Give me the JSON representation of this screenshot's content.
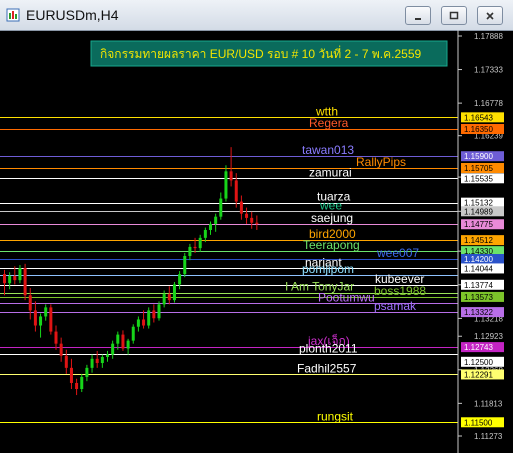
{
  "window": {
    "title": "EURUSDm,H4",
    "min_icon": "minimize-icon",
    "max_icon": "maximize-icon",
    "close_icon": "close-icon"
  },
  "header_text": "กิจกรรมทายผลราคา EUR/USD รอบ # 10 วันที่ 2 - 7 พ.ค.2559",
  "colors": {
    "background": "#000000",
    "bull": "#17d51a",
    "bear": "#e01414",
    "header_box": "#0a6b5c",
    "header_text": "#f2e600"
  },
  "axis_ticks": [
    "1.17888",
    "1.17333",
    "1.16778",
    "1.16239",
    "1.15555",
    "1.14989",
    "1.14330",
    "1.13774",
    "1.13218",
    "1.12923",
    "1.12368",
    "1.11813",
    "1.11273"
  ],
  "price_tags": [
    {
      "value": "1.16543",
      "bg": "#ffe100",
      "fg": "#000000"
    },
    {
      "value": "1.16350",
      "bg": "#ff6a00",
      "fg": "#000000"
    },
    {
      "value": "1.15900",
      "bg": "#6e5dd6",
      "fg": "#ffffff"
    },
    {
      "value": "1.15705",
      "bg": "#ff8a00",
      "fg": "#000000"
    },
    {
      "value": "1.15535",
      "bg": "#ffffff",
      "fg": "#000000"
    },
    {
      "value": "1.15132",
      "bg": "#ffffff",
      "fg": "#000000"
    },
    {
      "value": "1.14989",
      "bg": "#c8c8c8",
      "fg": "#000000"
    },
    {
      "value": "1.14775",
      "bg": "#e88ad8",
      "fg": "#000000"
    },
    {
      "value": "1.14512",
      "bg": "#ffa500",
      "fg": "#000000"
    },
    {
      "value": "1.14330",
      "bg": "#6be36b",
      "fg": "#000000"
    },
    {
      "value": "1.14200",
      "bg": "#2a52c9",
      "fg": "#ffffff"
    },
    {
      "value": "1.14044",
      "bg": "#ffffff",
      "fg": "#000000"
    },
    {
      "value": "1.13774",
      "bg": "#ffffff",
      "fg": "#000000"
    },
    {
      "value": "1.13573",
      "bg": "#7cc42a",
      "fg": "#000000"
    },
    {
      "value": "1.13322",
      "bg": "#b86ee8",
      "fg": "#000000"
    },
    {
      "value": "1.12743",
      "bg": "#c424c4",
      "fg": "#ffffff"
    },
    {
      "value": "1.12500",
      "bg": "#ffffff",
      "fg": "#000000"
    },
    {
      "value": "1.12291",
      "bg": "#ffff70",
      "fg": "#000000"
    },
    {
      "value": "1.11500",
      "bg": "#ffff00",
      "fg": "#000000"
    }
  ],
  "guesses": [
    {
      "name": "wtth",
      "value": 1.16543,
      "color": "#ffe100",
      "label_color": "#ffe100"
    },
    {
      "name": "Regera",
      "value": 1.1635,
      "color": "#ff6a00",
      "label_color": "#ff5a2a"
    },
    {
      "name": "tawan013",
      "value": 1.159,
      "color": "#6e5dd6",
      "label_color": "#8a7cff"
    },
    {
      "name": "RallyPips",
      "value": 1.15705,
      "color": "#ff8a00",
      "label_color": "#ff8a00"
    },
    {
      "name": "zamurai",
      "value": 1.15535,
      "color": "#ffffff",
      "label_color": "#ffffff"
    },
    {
      "name": "tuarza",
      "value": 1.15132,
      "color": "#ffffff",
      "label_color": "#ffffff"
    },
    {
      "name": "wee",
      "value": 1.14989,
      "color": "#c8c8c8",
      "label_color": "#1ec88a"
    },
    {
      "name": "saejung",
      "value": 1.14775,
      "color": "#e88ad8",
      "label_color": "#ffffff"
    },
    {
      "name": "bird2000",
      "value": 1.14512,
      "color": "#ffa500",
      "label_color": "#ffa500"
    },
    {
      "name": "Teerapong",
      "value": 1.1433,
      "color": "#6be36b",
      "label_color": "#6be36b"
    },
    {
      "name": "wee007",
      "value": 1.142,
      "color": "#2a52c9",
      "label_color": "#3d6bf0"
    },
    {
      "name": "narjant",
      "value": 1.14044,
      "color": "#ffffff",
      "label_color": "#ffffff"
    },
    {
      "name": "pomjipom",
      "value": 1.13935,
      "color": "#8fc3ff",
      "label_color": "#8fe0ff"
    },
    {
      "name": "kubeever",
      "value": 1.13774,
      "color": "#ffffff",
      "label_color": "#ffffff"
    },
    {
      "name": "I Am TonyJar",
      "value": 1.13643,
      "color": "#9be35a",
      "label_color": "#9be35a"
    },
    {
      "name": "boss1988",
      "value": 1.13573,
      "color": "#7cc42a",
      "label_color": "#7cc42a"
    },
    {
      "name": "Pootumwu",
      "value": 1.13465,
      "color": "#b86ee8",
      "label_color": "#c070ff"
    },
    {
      "name": "psamak",
      "value": 1.13322,
      "color": "#b86ee8",
      "label_color": "#a070ff"
    },
    {
      "name": "jax(เจ็ก)",
      "value": 1.12743,
      "color": "#c424c4",
      "label_color": "#d030d0"
    },
    {
      "name": "plonth2011",
      "value": 1.12623,
      "color": "#ffffff",
      "label_color": "#ffffff"
    },
    {
      "name": "Fadhil2557",
      "value": 1.12291,
      "color": "#ffff70",
      "label_color": "#ffffff"
    },
    {
      "name": "rungsit",
      "value": 1.115,
      "color": "#ffff00",
      "label_color": "#ffff00"
    }
  ],
  "candles": [
    [
      1.1395,
      1.1402,
      1.136,
      1.138
    ],
    [
      1.138,
      1.1398,
      1.137,
      1.1392
    ],
    [
      1.1392,
      1.1408,
      1.1378,
      1.1385
    ],
    [
      1.1385,
      1.141,
      1.138,
      1.1405
    ],
    [
      1.1405,
      1.1412,
      1.1352,
      1.136
    ],
    [
      1.136,
      1.1372,
      1.132,
      1.1335
    ],
    [
      1.1335,
      1.135,
      1.13,
      1.131
    ],
    [
      1.131,
      1.133,
      1.129,
      1.1325
    ],
    [
      1.1325,
      1.1345,
      1.1318,
      1.134
    ],
    [
      1.134,
      1.1345,
      1.1295,
      1.13
    ],
    [
      1.13,
      1.131,
      1.127,
      1.128
    ],
    [
      1.128,
      1.129,
      1.125,
      1.126
    ],
    [
      1.126,
      1.127,
      1.123,
      1.124
    ],
    [
      1.124,
      1.1255,
      1.1205,
      1.1215
    ],
    [
      1.1215,
      1.1222,
      1.1195,
      1.1205
    ],
    [
      1.1205,
      1.123,
      1.12,
      1.1225
    ],
    [
      1.1225,
      1.1245,
      1.1218,
      1.124
    ],
    [
      1.124,
      1.1262,
      1.1232,
      1.1255
    ],
    [
      1.1255,
      1.1268,
      1.124,
      1.1248
    ],
    [
      1.1248,
      1.1262,
      1.124,
      1.1258
    ],
    [
      1.1258,
      1.1268,
      1.125,
      1.1262
    ],
    [
      1.1262,
      1.1285,
      1.1255,
      1.128
    ],
    [
      1.128,
      1.13,
      1.127,
      1.1295
    ],
    [
      1.1295,
      1.1302,
      1.1268,
      1.1272
    ],
    [
      1.1272,
      1.1288,
      1.1262,
      1.1285
    ],
    [
      1.1285,
      1.1312,
      1.128,
      1.1308
    ],
    [
      1.1308,
      1.1325,
      1.13,
      1.132
    ],
    [
      1.132,
      1.1335,
      1.1305,
      1.131
    ],
    [
      1.131,
      1.134,
      1.1305,
      1.1335
    ],
    [
      1.1335,
      1.1345,
      1.1315,
      1.1322
    ],
    [
      1.1322,
      1.135,
      1.1318,
      1.1345
    ],
    [
      1.1345,
      1.1368,
      1.134,
      1.1362
    ],
    [
      1.1362,
      1.1375,
      1.1345,
      1.1352
    ],
    [
      1.1352,
      1.1382,
      1.1348,
      1.1378
    ],
    [
      1.1378,
      1.14,
      1.137,
      1.1395
    ],
    [
      1.1395,
      1.143,
      1.139,
      1.1425
    ],
    [
      1.1425,
      1.1445,
      1.1418,
      1.144
    ],
    [
      1.144,
      1.1455,
      1.143,
      1.1438
    ],
    [
      1.1438,
      1.146,
      1.1432,
      1.1455
    ],
    [
      1.1455,
      1.1472,
      1.1448,
      1.1468
    ],
    [
      1.1468,
      1.1482,
      1.146,
      1.1478
    ],
    [
      1.1478,
      1.1495,
      1.1465,
      1.149
    ],
    [
      1.149,
      1.153,
      1.1485,
      1.152
    ],
    [
      1.152,
      1.1575,
      1.1515,
      1.1565
    ],
    [
      1.1565,
      1.1605,
      1.154,
      1.155
    ],
    [
      1.155,
      1.1562,
      1.1505,
      1.1515
    ],
    [
      1.1515,
      1.1525,
      1.1485,
      1.1495
    ],
    [
      1.1495,
      1.1505,
      1.1478,
      1.1488
    ],
    [
      1.1488,
      1.1498,
      1.147,
      1.148
    ],
    [
      1.148,
      1.1492,
      1.1468,
      1.1478
    ]
  ]
}
